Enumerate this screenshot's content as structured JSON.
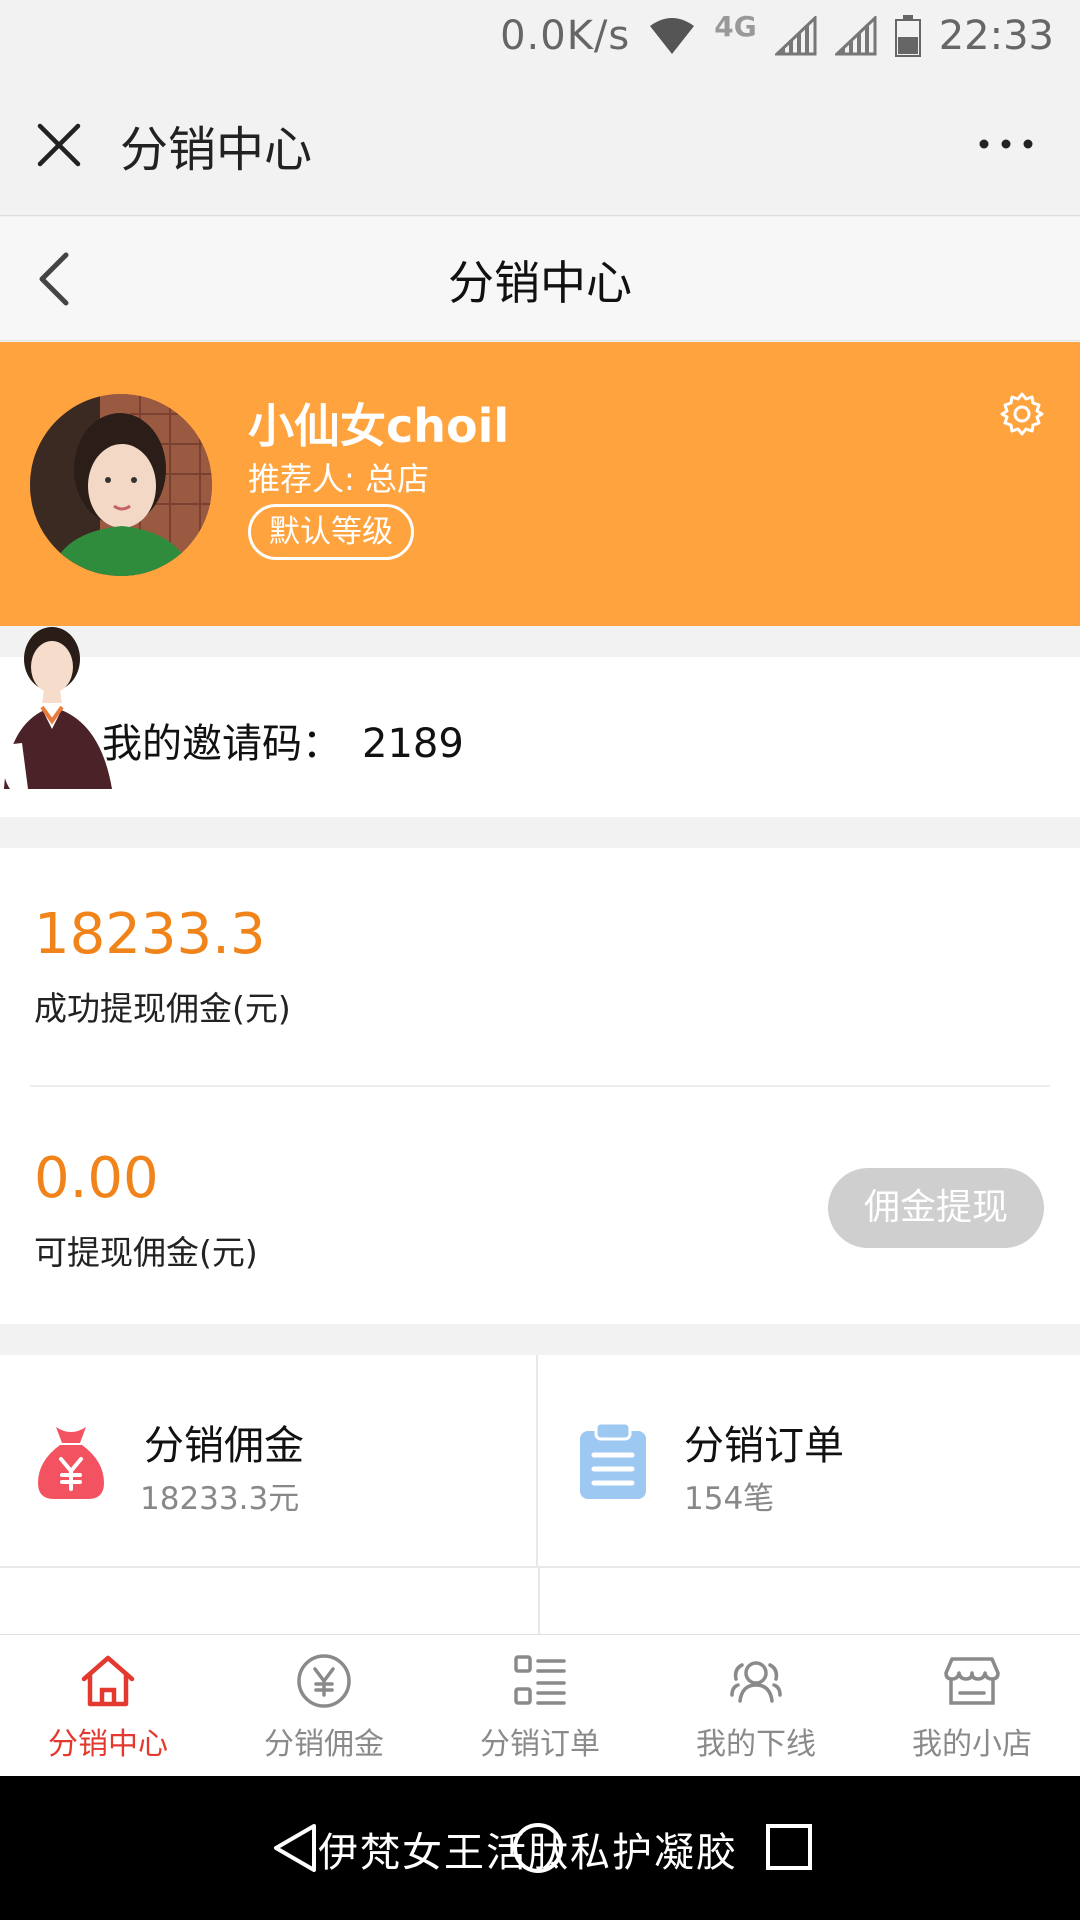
{
  "status_bar": {
    "net_speed": "0.0K/s",
    "network_type": "4G",
    "time": "22:33"
  },
  "wechat_bar": {
    "title": "分销中心",
    "close_icon": "close-icon",
    "more_icon": "more-dots-icon"
  },
  "nav_bar": {
    "title": "分销中心"
  },
  "profile": {
    "username": "小仙女choil",
    "referrer": "推荐人: 总店",
    "level": "默认等级",
    "colors": {
      "background": "#ffa33e"
    }
  },
  "invite": {
    "label": "我的邀请码：",
    "code": "2189"
  },
  "commission": {
    "withdrawn_amount": "18233.3",
    "withdrawn_label": "成功提现佣金(元)",
    "available_amount": "0.00",
    "available_label": "可提现佣金(元)",
    "withdraw_button": "佣金提现",
    "colors": {
      "amount": "#f0841a",
      "button_disabled": "#cfcfcf"
    }
  },
  "stats": [
    {
      "title": "分销佣金",
      "value": "18233.3元",
      "icon": "money-bag-icon",
      "color": "#f35360"
    },
    {
      "title": "分销订单",
      "value": "154笔",
      "icon": "clipboard-icon",
      "color": "#9cc8f2"
    }
  ],
  "tabbar": {
    "items": [
      {
        "label": "分销中心",
        "icon": "home-icon",
        "active": true
      },
      {
        "label": "分销佣金",
        "icon": "yen-circle-icon",
        "active": false
      },
      {
        "label": "分销订单",
        "icon": "list-grid-icon",
        "active": false
      },
      {
        "label": "我的下线",
        "icon": "team-icon",
        "active": false
      },
      {
        "label": "我的小店",
        "icon": "shop-icon",
        "active": false
      }
    ],
    "colors": {
      "active": "#e4392f",
      "inactive": "#8a8a8a"
    }
  },
  "system_nav": {
    "watermark": "伊梵女王活肽私护凝胶"
  }
}
